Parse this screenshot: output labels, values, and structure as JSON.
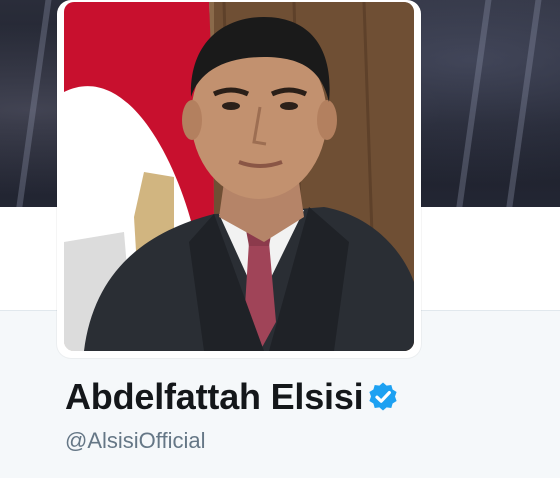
{
  "profile": {
    "name": "Abdelfattah Elsisi",
    "handle": "@AlsisiOfficial",
    "verified": true,
    "verified_icon": "verified-badge-icon",
    "avatar_alt": "profile-photo"
  },
  "colors": {
    "verified_blue": "#1da1f2",
    "name_text": "#14171a",
    "handle_text": "#657786",
    "page_background": "#f5f8fa"
  }
}
